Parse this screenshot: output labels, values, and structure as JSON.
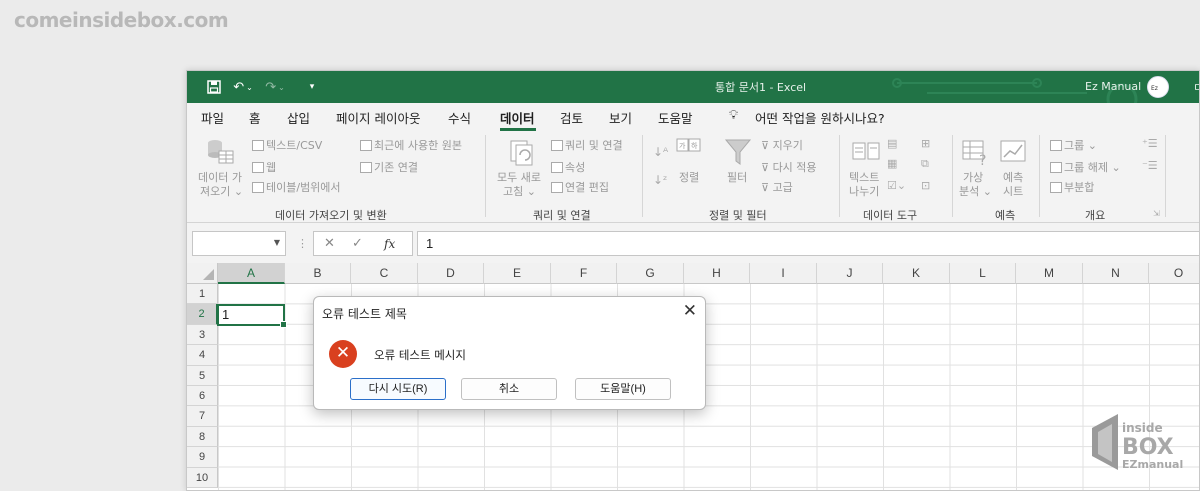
{
  "watermark": "comeinsidebox.com",
  "titlebar": {
    "document_title": "통합 문서1  -  Excel",
    "user_name": "Ez Manual",
    "right_partial": "ㄷ"
  },
  "tabs": [
    "파일",
    "홈",
    "삽입",
    "페이지 레이아웃",
    "수식",
    "데이터",
    "검토",
    "보기",
    "도움말"
  ],
  "active_tab": "데이터",
  "tell_me": "어떤 작업을 원하시나요?",
  "ribbon": {
    "get_data": {
      "label": "데이터 가져오기",
      "big_line1": "데이터 가",
      "big_line2": "져오기",
      "text_csv": "텍스트/CSV",
      "web": "웹",
      "table_range": "테이블/범위에서",
      "recent_sources": "최근에 사용한 원본",
      "existing_connections": "기존 연결",
      "group_label": "데이터 가져오기 및 변환"
    },
    "queries": {
      "refresh_line1": "모두 새로",
      "refresh_line2": "고침",
      "queries_connections": "쿼리 및 연결",
      "properties": "속성",
      "edit_links": "연결 편집",
      "group_label": "쿼리 및 연결"
    },
    "sort_filter": {
      "sort": "정렬",
      "filter": "필터",
      "clear": "지우기",
      "reapply": "다시 적용",
      "advanced": "고급",
      "group_label": "정렬 및 필터"
    },
    "data_tools": {
      "text_to_columns_line1": "텍스트",
      "text_to_columns_line2": "나누기",
      "group_label": "데이터 도구"
    },
    "forecast": {
      "what_if_line1": "가상",
      "what_if_line2": "분석",
      "forecast_line1": "예측",
      "forecast_line2": "시트",
      "group_label": "예측"
    },
    "outline": {
      "group": "그룹",
      "ungroup": "그룹 해제",
      "subtotal": "부분합",
      "group_label": "개요"
    }
  },
  "formula_bar": {
    "name_box": "",
    "fx": "fx",
    "value": "1"
  },
  "columns": [
    "A",
    "B",
    "C",
    "D",
    "E",
    "F",
    "G",
    "H",
    "I",
    "J",
    "K",
    "L",
    "M",
    "N",
    "O"
  ],
  "rows": [
    "1",
    "2",
    "3",
    "4",
    "5",
    "6",
    "7",
    "8",
    "9",
    "10"
  ],
  "active_cell_value": "1",
  "dialog": {
    "title": "오류 테스트 제목",
    "message": "오류 테스트 메시지",
    "retry_button": "다시 시도(R)",
    "cancel_button": "취소",
    "help_button": "도움말(H)",
    "close_glyph": "✕",
    "error_glyph": "✕"
  },
  "logo": {
    "line1": "inside",
    "line2": "BOX",
    "line3": "EZmanual"
  },
  "colors": {
    "excel_green": "#217346",
    "error_red": "#d9401f",
    "primary_button_border": "#2b6fc9"
  }
}
